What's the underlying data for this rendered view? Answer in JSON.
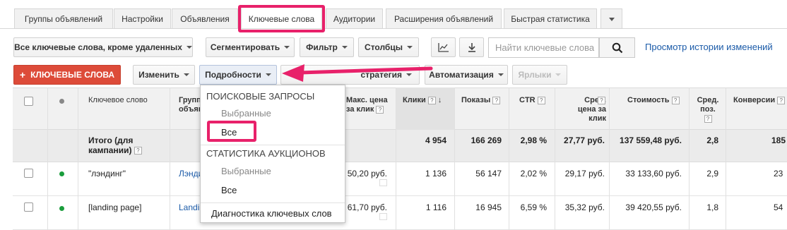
{
  "tabs": [
    "Группы объявлений",
    "Настройки",
    "Объявления",
    "Ключевые слова",
    "Аудитории",
    "Расширения объявлений",
    "Быстрая статистика"
  ],
  "toolbar1": {
    "filter_keywords": "Все ключевые слова, кроме удаленных",
    "segment": "Сегментировать",
    "filter": "Фильтр",
    "columns": "Столбцы",
    "search_placeholder": "Найти ключевые слова",
    "history_link": "Просмотр истории изменений"
  },
  "toolbar2": {
    "add_keywords": "КЛЮЧЕВЫЕ СЛОВА",
    "edit": "Изменить",
    "details": "Подробности",
    "bid_strategy": "стратегия",
    "automation": "Автоматизация",
    "labels": "Ярлыки"
  },
  "dropdown": {
    "section1": "ПОИСКОВЫЕ ЗАПРОСЫ",
    "s1_selected": "Выбранные",
    "s1_all": "Все",
    "section2": "СТАТИСТИКА АУКЦИОНОВ",
    "s2_selected": "Выбранные",
    "s2_all": "Все",
    "diagnostics": "Диагностика ключевых слов"
  },
  "table": {
    "headers": {
      "keyword": "Ключевое слово",
      "group": "Групп объявл",
      "max_cpc": "Макс. цена за клик",
      "clicks": "Клики",
      "impressions": "Показы",
      "ctr": "CTR",
      "avg_cpc": "Сред. цена за клик",
      "cost": "Стоимость",
      "avg_pos": "Сред. поз.",
      "conversions": "Конверсии"
    },
    "total": {
      "label": "Итого (для кампании)",
      "clicks": "4 954",
      "impressions": "166 269",
      "ctr": "2,98 %",
      "avg_cpc": "27,77 руб.",
      "cost": "137 559,48 руб.",
      "avg_pos": "2,8",
      "conversions": "185"
    },
    "rows": [
      {
        "keyword": "\"лэндинг\"",
        "group": "Лэнди",
        "max_cpc": "50,20 руб.",
        "clicks": "1 136",
        "impressions": "56 147",
        "ctr": "2,02 %",
        "avg_cpc": "29,17 руб.",
        "cost": "33 133,60 руб.",
        "avg_pos": "2,9",
        "conversions": "23"
      },
      {
        "keyword": "[landing page]",
        "group": "Landi",
        "max_cpc": "61,70 руб.",
        "clicks": "1 116",
        "impressions": "16 945",
        "ctr": "6,59 %",
        "avg_cpc": "35,32 руб.",
        "cost": "39 420,55 руб.",
        "avg_pos": "1,8",
        "conversions": "54"
      }
    ]
  },
  "colors": {
    "accent": "#dd4b39",
    "highlight": "#e8216a",
    "link": "#1a5aa8",
    "status_green": "#1a9d3c"
  }
}
